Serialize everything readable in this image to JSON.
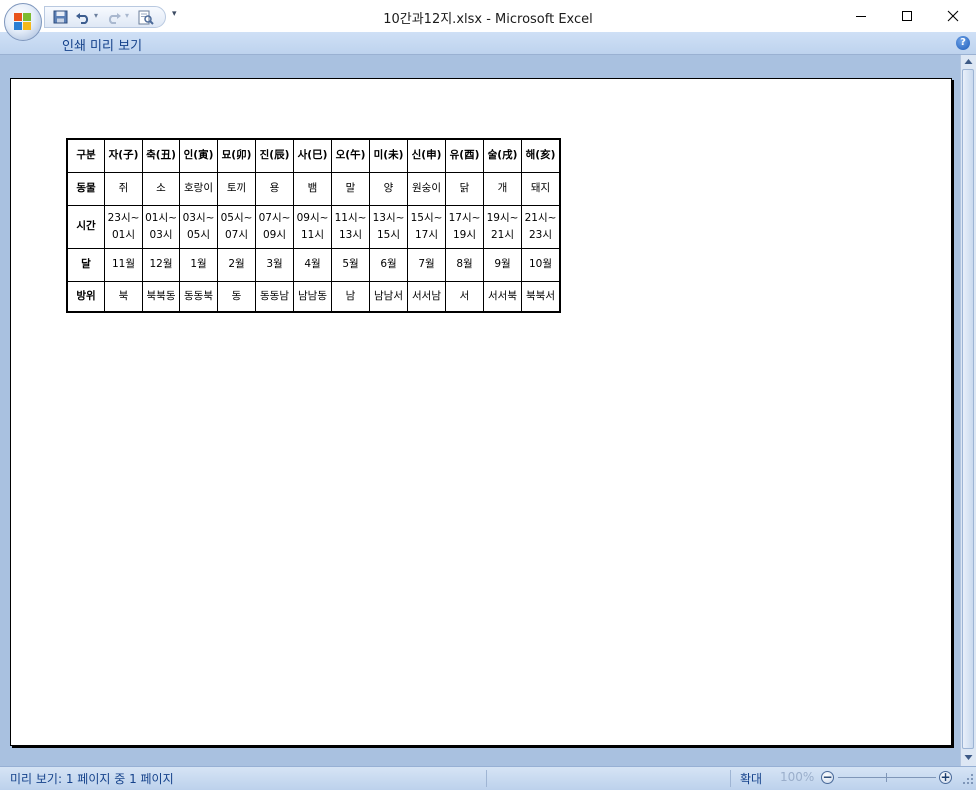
{
  "window": {
    "title": "10간과12지.xlsx - Microsoft Excel"
  },
  "ribbon": {
    "tab_label": "인쇄 미리 보기",
    "help": "?"
  },
  "status": {
    "page_info": "미리 보기: 1 페이지 중 1 페이지",
    "zoom_label": "확대",
    "zoom_value": "100%"
  },
  "table": {
    "rows": [
      [
        "구분",
        "자(子)",
        "축(丑)",
        "인(寅)",
        "묘(卯)",
        "진(辰)",
        "사(巳)",
        "오(午)",
        "미(未)",
        "신(申)",
        "유(酉)",
        "술(戌)",
        "해(亥)"
      ],
      [
        "동물",
        "쥐",
        "소",
        "호랑이",
        "토끼",
        "용",
        "뱀",
        "말",
        "양",
        "원숭이",
        "닭",
        "개",
        "돼지"
      ],
      [
        "시간",
        "23시~\n01시",
        "01시~\n03시",
        "03시~\n05시",
        "05시~\n07시",
        "07시~\n09시",
        "09시~\n11시",
        "11시~\n13시",
        "13시~\n15시",
        "15시~\n17시",
        "17시~\n19시",
        "19시~\n21시",
        "21시~\n23시"
      ],
      [
        "달",
        "11월",
        "12월",
        "1월",
        "2월",
        "3월",
        "4월",
        "5월",
        "6월",
        "7월",
        "8월",
        "9월",
        "10월"
      ],
      [
        "방위",
        "북",
        "북북동",
        "동동북",
        "동",
        "동동남",
        "남남동",
        "남",
        "남남서",
        "서서남",
        "서",
        "서서북",
        "북북서"
      ]
    ]
  }
}
